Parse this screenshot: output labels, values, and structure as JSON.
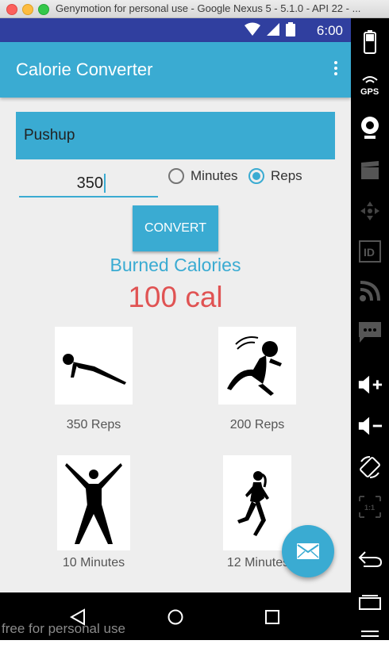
{
  "window": {
    "title": "Genymotion for personal use - Google Nexus 5 - 5.1.0 - API 22 - ..."
  },
  "status_bar": {
    "time": "6:00"
  },
  "app_bar": {
    "title": "Calorie Converter"
  },
  "form": {
    "exercise_value": "Pushup",
    "amount_value": "350",
    "unit_options": [
      {
        "label": "Minutes",
        "checked": false
      },
      {
        "label": "Reps",
        "checked": true
      }
    ],
    "convert_label": "CONVERT"
  },
  "result": {
    "label": "Burned Calories",
    "value": "100 cal"
  },
  "tiles": [
    {
      "icon": "pushup-icon",
      "label": "350 Reps"
    },
    {
      "icon": "situp-icon",
      "label": "200 Reps"
    },
    {
      "icon": "jumping-jack-icon",
      "label": "10 Minutes"
    },
    {
      "icon": "jogging-icon",
      "label": "12 Minutes"
    }
  ],
  "fab": {
    "icon": "email-icon"
  },
  "watermark": "free for personal use",
  "sidebar": {
    "icons": [
      "battery-icon",
      "gps-icon",
      "webcam-icon",
      "video-icon",
      "dpad-icon",
      "id-icon",
      "rss-icon",
      "sms-icon",
      "volume-up-icon",
      "volume-down-icon",
      "rotate-icon",
      "pixel-perfect-icon",
      "back-icon",
      "recents-icon"
    ]
  },
  "colors": {
    "accent": "#3aabd2",
    "status_bar": "#303f9f",
    "result_value": "#e05353"
  }
}
